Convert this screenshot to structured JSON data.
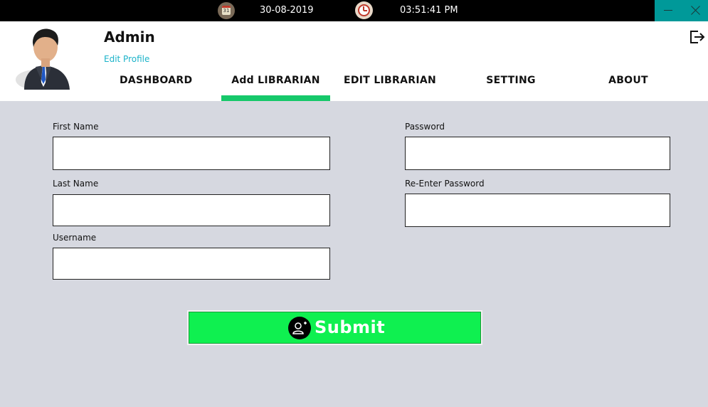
{
  "topbar": {
    "calendar_icon_day": "31",
    "date": "30-08-2019",
    "time": "03:51:41 PM",
    "background": "#000000",
    "window_controls_color": "#009999"
  },
  "header": {
    "user_name": "Admin",
    "edit_profile": "Edit Profile",
    "edit_profile_color": "#1bb3c9"
  },
  "nav": {
    "tabs": [
      {
        "label": "DASHBOARD",
        "active": false
      },
      {
        "label": "Add LIBRARIAN",
        "active": true
      },
      {
        "label": "EDIT LIBRARIAN",
        "active": false
      },
      {
        "label": "SETTING",
        "active": false
      },
      {
        "label": "ABOUT",
        "active": false
      }
    ],
    "active_color": "#16c86a"
  },
  "form": {
    "first_name_label": "First Name",
    "first_name_value": "",
    "last_name_label": "Last Name",
    "last_name_value": "",
    "username_label": "Username",
    "username_value": "",
    "password_label": "Password",
    "password_value": "",
    "reenter_password_label": "Re-Enter Password",
    "reenter_password_value": "",
    "submit_label": "Submit",
    "submit_color": "#0ff050",
    "background": "#d6d8e0"
  }
}
